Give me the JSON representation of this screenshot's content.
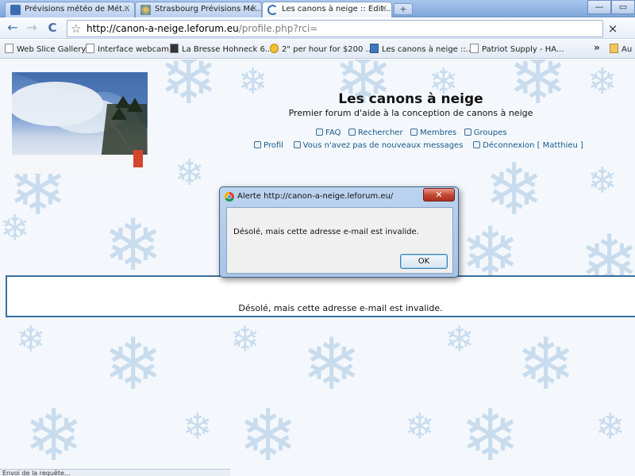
{
  "browser": {
    "tabs": [
      {
        "label": "Prévisions météo de Mét...",
        "favicon": "page-icon",
        "close": "×"
      },
      {
        "label": "Strasbourg Prévisions Mé...",
        "favicon": "weather-icon",
        "close": "×"
      },
      {
        "label": "Les canons à neige :: Edit...",
        "favicon": "loading-icon",
        "close": "×"
      }
    ],
    "new_tab": "+",
    "window_controls": {
      "minimize": "—",
      "maximize": "▭"
    },
    "nav": {
      "back": "←",
      "forward": "→",
      "reload": "C",
      "star": "☆",
      "stop": "×"
    },
    "url": {
      "host": "http://canon-a-neige.leforum.eu",
      "path": "/profile.php?rci="
    },
    "bookmarks": [
      {
        "label": "Web Slice Gallery"
      },
      {
        "label": "Interface webcam"
      },
      {
        "label": "La Bresse Hohneck 6..."
      },
      {
        "label": "2\" per hour for $200 ..."
      },
      {
        "label": "Les canons à neige ::..."
      },
      {
        "label": "Patriot Supply - HA..."
      }
    ],
    "bookmarks_more": "»",
    "other_bookmarks": "Au"
  },
  "site": {
    "title": "Les canons à neige",
    "description": "Premier forum d'aide à la conception de canons à neige",
    "nav1": [
      "FAQ",
      "Rechercher",
      "Membres",
      "Groupes"
    ],
    "nav2": {
      "profile": "Profil",
      "messages": "Vous n'avez pas de nouveaux messages",
      "logout": "Déconnexion [ Matthieu ]"
    }
  },
  "message": "Désolé, mais cette adresse e-mail est invalide.",
  "status_text": "Envoi de la requête...",
  "dialog": {
    "title": "Alerte http://canon-a-neige.leforum.eu/",
    "close": "✕",
    "message": "Désolé, mais cette adresse e-mail est invalide.",
    "ok": "OK"
  },
  "colors": {
    "background_flake": "#c9dcee",
    "link": "#17598a",
    "message_border": "#3a6f9a"
  }
}
